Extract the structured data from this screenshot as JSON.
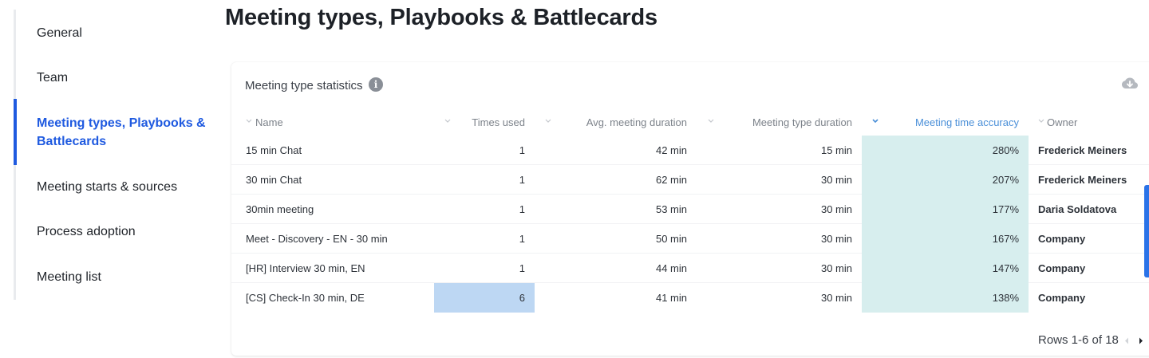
{
  "sidebar": {
    "items": [
      {
        "label": "General"
      },
      {
        "label": "Team"
      },
      {
        "label": "Meeting types, Playbooks & Battlecards",
        "active": true
      },
      {
        "label": "Meeting starts & sources"
      },
      {
        "label": "Process adoption"
      },
      {
        "label": "Meeting list"
      }
    ]
  },
  "page": {
    "title": "Meeting types, Playbooks & Battlecards"
  },
  "card": {
    "title": "Meeting type statistics",
    "info_icon": "i",
    "download_icon": "cloud-download-icon"
  },
  "table": {
    "columns": [
      {
        "label": "Name"
      },
      {
        "label": "Times used"
      },
      {
        "label": "Avg. meeting duration"
      },
      {
        "label": "Meeting type duration"
      },
      {
        "label": "Meeting time accuracy",
        "sorted": true
      },
      {
        "label": "Owner"
      }
    ],
    "rows": [
      {
        "name": "15 min Chat",
        "times_used": "1",
        "avg_duration": "42 min",
        "type_duration": "15 min",
        "accuracy": "280%",
        "owner": "Frederick Meiners"
      },
      {
        "name": "30 min Chat",
        "times_used": "1",
        "avg_duration": "62 min",
        "type_duration": "30 min",
        "accuracy": "207%",
        "owner": "Frederick Meiners"
      },
      {
        "name": "30min meeting",
        "times_used": "1",
        "avg_duration": "53 min",
        "type_duration": "30 min",
        "accuracy": "177%",
        "owner": "Daria Soldatova"
      },
      {
        "name": "Meet - Discovery - EN - 30 min",
        "times_used": "1",
        "avg_duration": "50 min",
        "type_duration": "30 min",
        "accuracy": "167%",
        "owner": "Company"
      },
      {
        "name": "[HR] Interview 30 min, EN",
        "times_used": "1",
        "avg_duration": "44 min",
        "type_duration": "30 min",
        "accuracy": "147%",
        "owner": "Company"
      },
      {
        "name": "[CS] Check-In 30 min, DE",
        "times_used": "6",
        "avg_duration": "41 min",
        "type_duration": "30 min",
        "accuracy": "138%",
        "owner": "Company",
        "highlight_times_used": true
      }
    ]
  },
  "pager": {
    "label": "Rows 1-6 of 18"
  },
  "colors": {
    "accent": "#1f5ae0",
    "sorted_header": "#4a8fd8",
    "highlight_blue": "#bdd7f3",
    "highlight_teal": "#d7eeee"
  }
}
